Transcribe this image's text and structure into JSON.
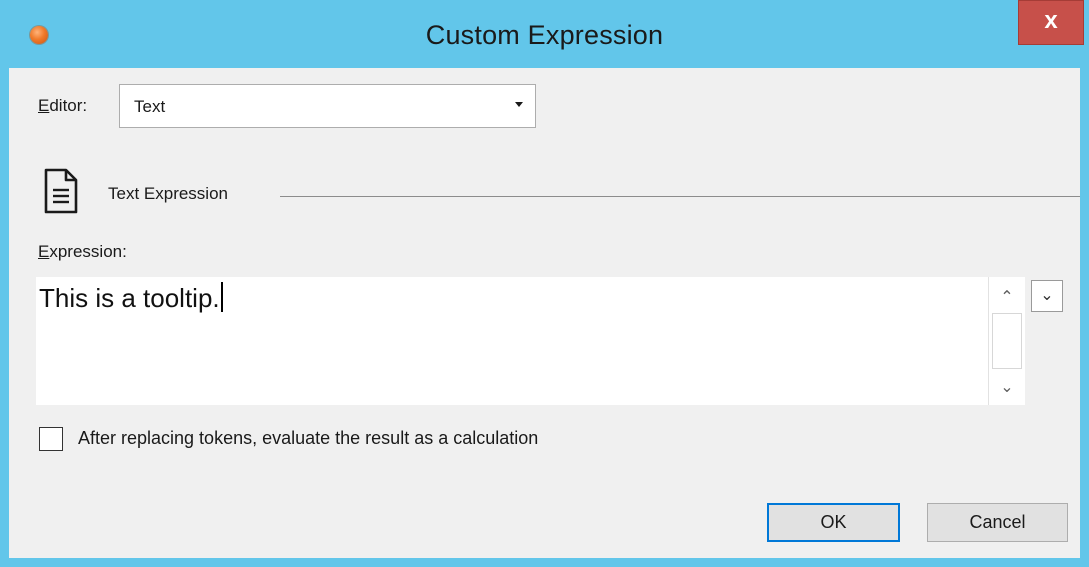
{
  "window": {
    "title": "Custom Expression",
    "close_label": "x",
    "accent": "#62c6ea",
    "close_color": "#c7504a"
  },
  "editor": {
    "label_accel": "E",
    "label_rest": "ditor:",
    "selected": "Text"
  },
  "section": {
    "icon": "document-icon",
    "title": "Text Expression"
  },
  "expression": {
    "label_accel": "E",
    "label_rest": "xpression:",
    "value": "This is a tooltip."
  },
  "scrollbar": {
    "up_glyph": "⌃",
    "down_glyph": "⌄"
  },
  "expand_glyph": "⌄",
  "option": {
    "checked": false,
    "label": "After replacing tokens, evaluate the result as a calculation"
  },
  "buttons": {
    "ok": "OK",
    "cancel": "Cancel"
  }
}
